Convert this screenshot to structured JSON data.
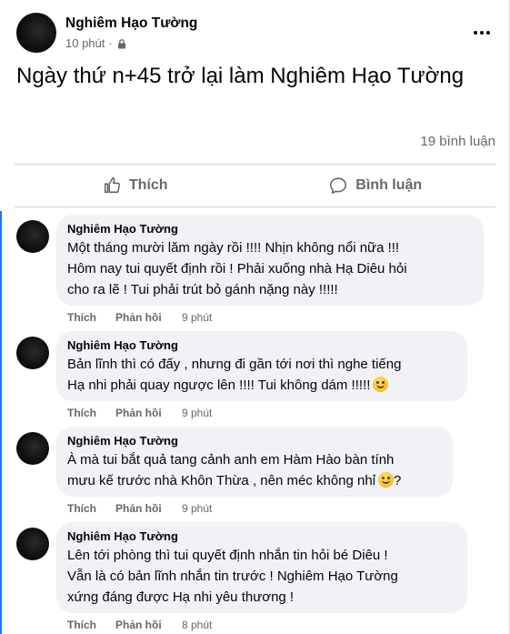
{
  "post": {
    "author": "Nghiêm Hạo Tường",
    "time": "10 phút",
    "privacy_icon": "lock-icon",
    "text": "Ngày thứ n+45 trở lại làm Nghiêm Hạo Tường",
    "comment_count": "19 bình luận",
    "like_label": "Thích",
    "comment_label": "Bình luận"
  },
  "comments": [
    {
      "author": "Nghiêm Hạo Tường",
      "text": "Một tháng mười lăm ngày rồi !!!! Nhịn không nổi nữa !!!\nHôm nay tui quyết định rồi ! Phải xuống nhà Hạ Diêu hỏi\ncho ra lẽ ! Tui phải trút bỏ gánh nặng này !!!!!",
      "like": "Thích",
      "reply": "Phản hồi",
      "time": "9 phút"
    },
    {
      "author": "Nghiêm Hạo Tường",
      "text": "Bản lĩnh thì có đấy , nhưng đi gần tới nơi thì nghe tiếng\nHạ nhi phải quay ngược lên !!!! Tui không dám !!!!!",
      "like": "Thích",
      "reply": "Phản hồi",
      "time": "9 phút"
    },
    {
      "author": "Nghiêm Hạo Tường",
      "text": "À mà tui bắt quả tang cảnh anh em Hàm Hào bàn tính\nmưu kế trước nhà Khôn Thừa , nên méc không nhỉ",
      "text_suffix": "?",
      "like": "Thích",
      "reply": "Phản hồi",
      "time": "9 phút"
    },
    {
      "author": "Nghiêm Hạo Tường",
      "text": "Lên tới phòng thì tui quyết định nhắn tin hỏi bé Diêu !\nVẫn là có bản lĩnh nhắn tin trước ! Nghiêm Hạo Tường\nxứng đáng được Hạ nhi yêu thương !",
      "like": "Thích",
      "reply": "Phản hồi",
      "time": "8 phút"
    }
  ]
}
